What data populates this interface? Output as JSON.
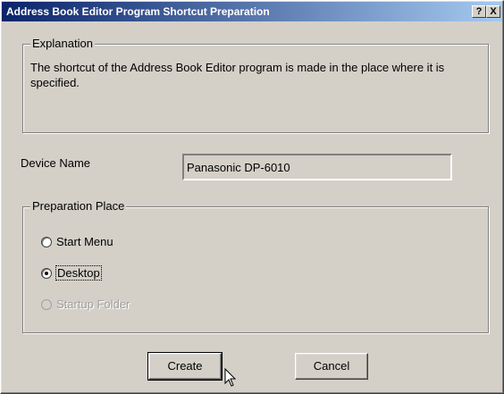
{
  "window": {
    "title": "Address Book Editor Program Shortcut Preparation",
    "help_glyph": "?",
    "close_glyph": "X"
  },
  "explanation": {
    "legend": "Explanation",
    "text": "The shortcut of the Address Book Editor program is made in the place where it is specified."
  },
  "device": {
    "label": "Device Name",
    "value": "Panasonic DP-6010"
  },
  "preparation_place": {
    "legend": "Preparation Place",
    "options": [
      {
        "label": "Start Menu",
        "checked": false,
        "enabled": true
      },
      {
        "label": "Desktop",
        "checked": true,
        "enabled": true
      },
      {
        "label": "Startup Folder",
        "checked": false,
        "enabled": false
      }
    ]
  },
  "buttons": {
    "create": "Create",
    "cancel": "Cancel"
  },
  "colors": {
    "titlebar_start": "#0a246a",
    "titlebar_end": "#a6caf0",
    "face": "#d4d0c8"
  }
}
